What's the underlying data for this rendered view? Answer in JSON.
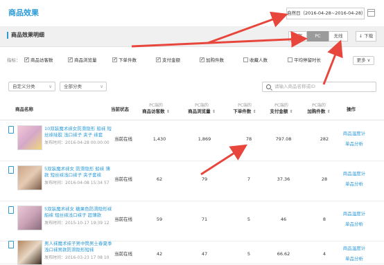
{
  "header": {
    "title": "商品效果",
    "date_range": "自然日（2016-04-28~2016-04-28）"
  },
  "section": {
    "title": "商品效果明细",
    "tabs": [
      "全部",
      "PC",
      "无线"
    ],
    "download": "↓ 下载"
  },
  "metrics": {
    "label": "指标：",
    "items": [
      {
        "label": "商品访客数",
        "checked": true
      },
      {
        "label": "商品浏览量",
        "checked": true
      },
      {
        "label": "下单件数",
        "checked": true
      },
      {
        "label": "支付金额",
        "checked": true
      },
      {
        "label": "加购件数",
        "checked": true
      },
      {
        "label": "收藏人数",
        "checked": false
      },
      {
        "label": "平均停留时长",
        "checked": false
      }
    ],
    "more": "更多"
  },
  "filters": {
    "custom_category": "自定义分类",
    "all_category": "全部分类",
    "search_placeholder": "请输入商品名称或ID"
  },
  "table": {
    "headers": {
      "name": "商品名称",
      "status": "当前状态",
      "visitors": [
        "PC端的",
        "商品访客数"
      ],
      "views": [
        "PC端的",
        "商品浏览量"
      ],
      "orders": [
        "PC端的",
        "下单件数"
      ],
      "pay": [
        "PC端的",
        "支付金额"
      ],
      "cart": [
        "PC端的",
        "加购件数"
      ],
      "op": "操作"
    },
    "rows": [
      {
        "name": "10双装魔术袜女防滑隐形 船袜 短丝袜硅胶 浅口袜子 夹子 袜套",
        "time": "发布时间：2016-04-28 00:00:00",
        "status": "当前在线",
        "visitors": "1,430",
        "views": "1,869",
        "orders": "78",
        "pay": "797.08",
        "cart": "282",
        "op1": "商品温度计",
        "op2": "单品分析"
      },
      {
        "name": "5双装魔术袜女 防滑隐形 船袜 薄款 短丝袜浅口袜子 夹子套袜",
        "time": "发布时间：2016-04-08 15:34 57",
        "status": "当前在线",
        "visitors": "62",
        "views": "79",
        "orders": "7",
        "pay": "37.36",
        "cart": "28",
        "op1": "商品温度计",
        "op2": "单品分析"
      },
      {
        "name": "5双装魔术袜女 糖果色防滑隐形袜船袜 短丝袜浅口袜子 超薄款",
        "time": "发布时间：2015-10-17 19:39 12",
        "status": "当前在线",
        "visitors": "59",
        "views": "71",
        "orders": "5",
        "pay": "46",
        "cart": "8",
        "op1": "商品温度计",
        "op2": "单品分析"
      },
      {
        "name": "男人袜魔术袜子男中筒男士春夏季浅口袜男款防滑隐形短袜",
        "time": "发布时间：2016-03-23 17 08 10",
        "status": "当前在线",
        "visitors": "42",
        "views": "47",
        "orders": "5",
        "pay": "66.62",
        "cart": "4",
        "op1": "商品温度计",
        "op2": "单品分析"
      }
    ]
  },
  "colors": {
    "accent": "#2b9ad8",
    "arrow": "#e8463c"
  }
}
